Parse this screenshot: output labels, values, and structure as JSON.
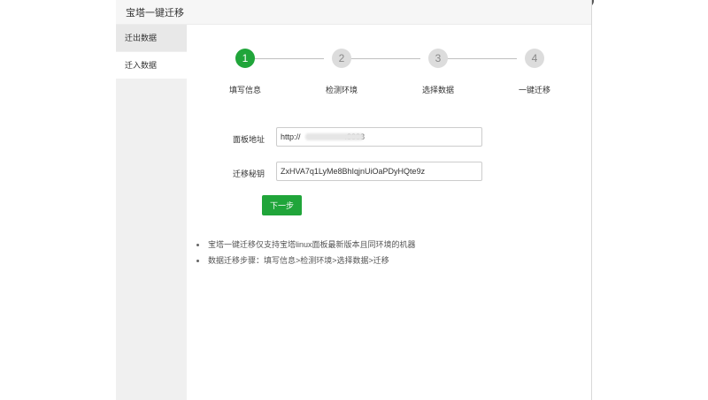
{
  "dialog": {
    "title": "宝塔一键迁移"
  },
  "sidebar": {
    "items": [
      {
        "label": "迁出数据"
      },
      {
        "label": "迁入数据"
      }
    ]
  },
  "steps": [
    {
      "number": "1",
      "label": "填写信息",
      "active": true
    },
    {
      "number": "2",
      "label": "检测环境",
      "active": false
    },
    {
      "number": "3",
      "label": "选择数据",
      "active": false
    },
    {
      "number": "4",
      "label": "一键迁移",
      "active": false
    }
  ],
  "form": {
    "panel_address": {
      "label": "面板地址",
      "value": "http://                    :8888"
    },
    "migrate_key": {
      "label": "迁移秘钥",
      "value": "ZxHVA7q1LyMe8BhIqjnUiOaPDyHQte9z"
    },
    "next_label": "下一步"
  },
  "notes": [
    "宝塔一键迁移仅支持宝塔linux面板最新版本且同环境的机器",
    "数据迁移步骤：填写信息>检测环境>选择数据>迁移"
  ],
  "colors": {
    "accent": "#20a53a",
    "inactive_step": "#dcdcdc"
  }
}
